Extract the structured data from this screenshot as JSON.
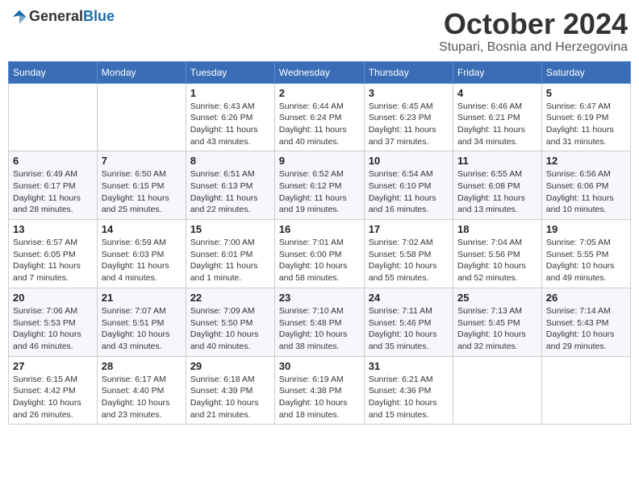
{
  "header": {
    "logo_general": "General",
    "logo_blue": "Blue",
    "month": "October 2024",
    "location": "Stupari, Bosnia and Herzegovina"
  },
  "days_of_week": [
    "Sunday",
    "Monday",
    "Tuesday",
    "Wednesday",
    "Thursday",
    "Friday",
    "Saturday"
  ],
  "weeks": [
    [
      {
        "day": "",
        "info": ""
      },
      {
        "day": "",
        "info": ""
      },
      {
        "day": "1",
        "info": "Sunrise: 6:43 AM\nSunset: 6:26 PM\nDaylight: 11 hours and 43 minutes."
      },
      {
        "day": "2",
        "info": "Sunrise: 6:44 AM\nSunset: 6:24 PM\nDaylight: 11 hours and 40 minutes."
      },
      {
        "day": "3",
        "info": "Sunrise: 6:45 AM\nSunset: 6:23 PM\nDaylight: 11 hours and 37 minutes."
      },
      {
        "day": "4",
        "info": "Sunrise: 6:46 AM\nSunset: 6:21 PM\nDaylight: 11 hours and 34 minutes."
      },
      {
        "day": "5",
        "info": "Sunrise: 6:47 AM\nSunset: 6:19 PM\nDaylight: 11 hours and 31 minutes."
      }
    ],
    [
      {
        "day": "6",
        "info": "Sunrise: 6:49 AM\nSunset: 6:17 PM\nDaylight: 11 hours and 28 minutes."
      },
      {
        "day": "7",
        "info": "Sunrise: 6:50 AM\nSunset: 6:15 PM\nDaylight: 11 hours and 25 minutes."
      },
      {
        "day": "8",
        "info": "Sunrise: 6:51 AM\nSunset: 6:13 PM\nDaylight: 11 hours and 22 minutes."
      },
      {
        "day": "9",
        "info": "Sunrise: 6:52 AM\nSunset: 6:12 PM\nDaylight: 11 hours and 19 minutes."
      },
      {
        "day": "10",
        "info": "Sunrise: 6:54 AM\nSunset: 6:10 PM\nDaylight: 11 hours and 16 minutes."
      },
      {
        "day": "11",
        "info": "Sunrise: 6:55 AM\nSunset: 6:08 PM\nDaylight: 11 hours and 13 minutes."
      },
      {
        "day": "12",
        "info": "Sunrise: 6:56 AM\nSunset: 6:06 PM\nDaylight: 11 hours and 10 minutes."
      }
    ],
    [
      {
        "day": "13",
        "info": "Sunrise: 6:57 AM\nSunset: 6:05 PM\nDaylight: 11 hours and 7 minutes."
      },
      {
        "day": "14",
        "info": "Sunrise: 6:59 AM\nSunset: 6:03 PM\nDaylight: 11 hours and 4 minutes."
      },
      {
        "day": "15",
        "info": "Sunrise: 7:00 AM\nSunset: 6:01 PM\nDaylight: 11 hours and 1 minute."
      },
      {
        "day": "16",
        "info": "Sunrise: 7:01 AM\nSunset: 6:00 PM\nDaylight: 10 hours and 58 minutes."
      },
      {
        "day": "17",
        "info": "Sunrise: 7:02 AM\nSunset: 5:58 PM\nDaylight: 10 hours and 55 minutes."
      },
      {
        "day": "18",
        "info": "Sunrise: 7:04 AM\nSunset: 5:56 PM\nDaylight: 10 hours and 52 minutes."
      },
      {
        "day": "19",
        "info": "Sunrise: 7:05 AM\nSunset: 5:55 PM\nDaylight: 10 hours and 49 minutes."
      }
    ],
    [
      {
        "day": "20",
        "info": "Sunrise: 7:06 AM\nSunset: 5:53 PM\nDaylight: 10 hours and 46 minutes."
      },
      {
        "day": "21",
        "info": "Sunrise: 7:07 AM\nSunset: 5:51 PM\nDaylight: 10 hours and 43 minutes."
      },
      {
        "day": "22",
        "info": "Sunrise: 7:09 AM\nSunset: 5:50 PM\nDaylight: 10 hours and 40 minutes."
      },
      {
        "day": "23",
        "info": "Sunrise: 7:10 AM\nSunset: 5:48 PM\nDaylight: 10 hours and 38 minutes."
      },
      {
        "day": "24",
        "info": "Sunrise: 7:11 AM\nSunset: 5:46 PM\nDaylight: 10 hours and 35 minutes."
      },
      {
        "day": "25",
        "info": "Sunrise: 7:13 AM\nSunset: 5:45 PM\nDaylight: 10 hours and 32 minutes."
      },
      {
        "day": "26",
        "info": "Sunrise: 7:14 AM\nSunset: 5:43 PM\nDaylight: 10 hours and 29 minutes."
      }
    ],
    [
      {
        "day": "27",
        "info": "Sunrise: 6:15 AM\nSunset: 4:42 PM\nDaylight: 10 hours and 26 minutes."
      },
      {
        "day": "28",
        "info": "Sunrise: 6:17 AM\nSunset: 4:40 PM\nDaylight: 10 hours and 23 minutes."
      },
      {
        "day": "29",
        "info": "Sunrise: 6:18 AM\nSunset: 4:39 PM\nDaylight: 10 hours and 21 minutes."
      },
      {
        "day": "30",
        "info": "Sunrise: 6:19 AM\nSunset: 4:38 PM\nDaylight: 10 hours and 18 minutes."
      },
      {
        "day": "31",
        "info": "Sunrise: 6:21 AM\nSunset: 4:36 PM\nDaylight: 10 hours and 15 minutes."
      },
      {
        "day": "",
        "info": ""
      },
      {
        "day": "",
        "info": ""
      }
    ]
  ]
}
